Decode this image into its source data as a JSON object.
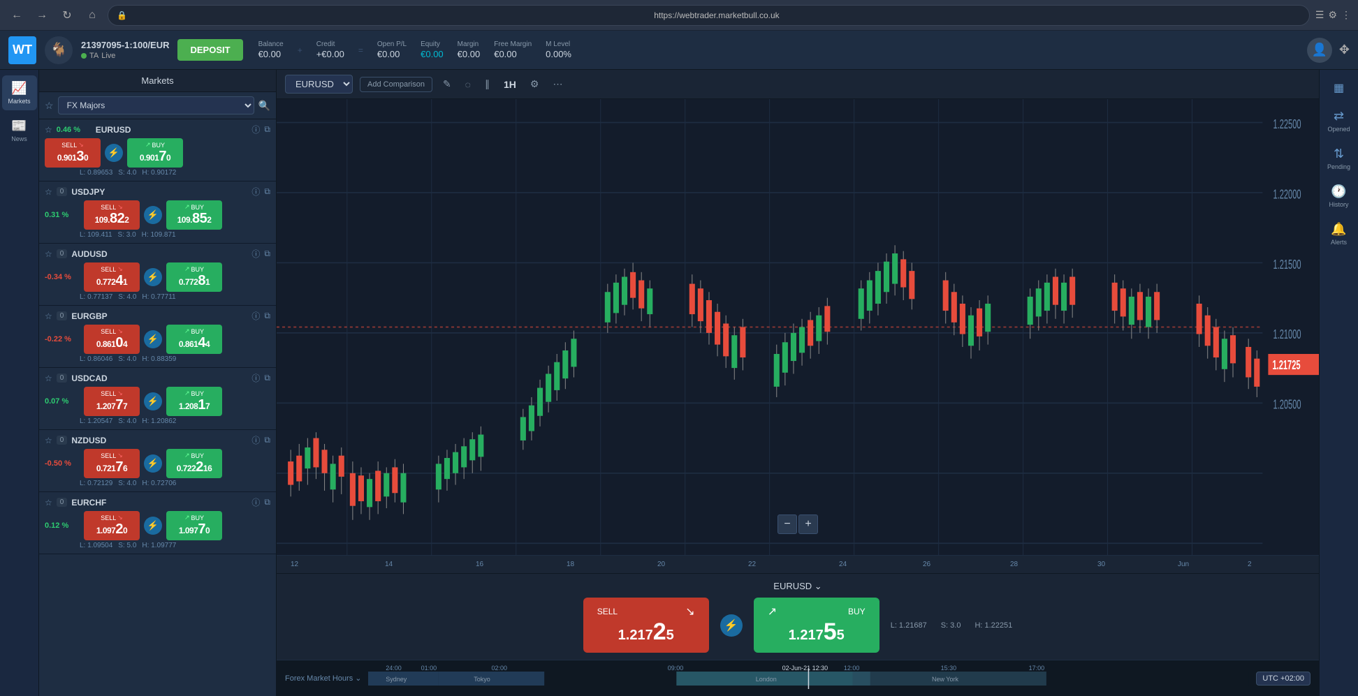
{
  "browser": {
    "url": "https://webtrader.marketbull.co.uk",
    "back": "←",
    "forward": "→",
    "refresh": "↻",
    "home": "⌂"
  },
  "header": {
    "logo_wt": "WT",
    "account_id": "21397095-1:100/EUR",
    "account_ta": "TA",
    "account_live": "Live",
    "deposit_label": "DEPOSIT",
    "balance_label": "Balance",
    "balance_value": "€0.00",
    "credit_label": "Credit",
    "credit_value": "+€0.00",
    "open_pl_label": "Open P/L",
    "open_pl_value": "€0.00",
    "equity_label": "Equity",
    "equity_value": "€0.00",
    "margin_label": "Margin",
    "margin_value": "€0.00",
    "free_margin_label": "Free Margin",
    "free_margin_value": "€0.00",
    "m_level_label": "M Level",
    "m_level_value": "0.00%"
  },
  "sidebar": {
    "markets_label": "Markets",
    "news_label": "News"
  },
  "markets_panel": {
    "title": "Markets",
    "fx_filter": "FX Majors",
    "items": [
      {
        "name": "EURUSD",
        "change": "0.46 %",
        "change_type": "positive",
        "sell_label": "SELL",
        "sell_price_main": "0.9013",
        "sell_price_sub": "0",
        "buy_label": "BUY",
        "buy_price_main": "0.9017",
        "buy_price_sub": "0",
        "low": "L: 0.89653",
        "spread": "S: 4.0",
        "high": "H: 0.90172",
        "count": ""
      },
      {
        "name": "USDJPY",
        "change": "0.31 %",
        "change_type": "positive",
        "sell_label": "SELL",
        "sell_price_main": "109.82",
        "sell_price_sub": "2",
        "buy_label": "BUY",
        "buy_price_main": "109.85",
        "buy_price_sub": "2",
        "low": "L: 109.411",
        "spread": "S: 3.0",
        "high": "H: 109.871",
        "count": "0"
      },
      {
        "name": "AUDUSD",
        "change": "-0.34 %",
        "change_type": "negative",
        "sell_label": "SELL",
        "sell_price_main": "0.7724",
        "sell_price_sub": "1",
        "buy_label": "BUY",
        "buy_price_main": "0.7728",
        "buy_price_sub": "1",
        "low": "L: 0.77137",
        "spread": "S: 4.0",
        "high": "H: 0.77711",
        "count": "0"
      },
      {
        "name": "EURGBP",
        "change": "-0.22 %",
        "change_type": "negative",
        "sell_label": "SELL",
        "sell_price_main": "0.8610",
        "sell_price_sub": "4",
        "buy_label": "BUY",
        "buy_price_main": "0.8614",
        "buy_price_sub": "4",
        "low": "L: 0.86046",
        "spread": "S: 4.0",
        "high": "H: 0.88359",
        "count": "0"
      },
      {
        "name": "USDCAD",
        "change": "0.07 %",
        "change_type": "positive",
        "sell_label": "SELL",
        "sell_price_main": "1.2077",
        "sell_price_sub": "7",
        "buy_label": "BUY",
        "buy_price_main": "1.2081",
        "buy_price_sub": "7",
        "low": "L: 1.20547",
        "spread": "S: 4.0",
        "high": "H: 1.20862",
        "count": "0"
      },
      {
        "name": "NZDUSD",
        "change": "-0.50 %",
        "change_type": "negative",
        "sell_label": "SELL",
        "sell_price_main": "0.7217",
        "sell_price_sub": "6",
        "buy_label": "BUY",
        "buy_price_main": "0.7221",
        "buy_price_sub": "6",
        "low": "L: 0.72129",
        "spread": "S: 4.0",
        "high": "H: 0.72706",
        "count": "0"
      },
      {
        "name": "EURCHF",
        "change": "0.12 %",
        "change_type": "positive",
        "sell_label": "SELL",
        "sell_price_main": "1.0972",
        "sell_price_sub": "0",
        "buy_label": "BUY",
        "buy_price_main": "1.0977",
        "buy_price_sub": "0",
        "low": "L: 1.09504",
        "spread": "S: 5.0",
        "high": "H: 1.09777",
        "count": "0"
      }
    ]
  },
  "chart": {
    "symbol": "EURUSD",
    "add_comparison": "Add Comparison",
    "timeframe": "1H",
    "current_price": "1.21725",
    "price_levels": [
      "1.22500",
      "1.22000",
      "1.21500",
      "1.21000",
      "1.20500"
    ],
    "time_labels": [
      "12",
      "14",
      "16",
      "18",
      "20",
      "22",
      "24",
      "26",
      "28",
      "30",
      "Jun",
      "2"
    ],
    "zoom_minus": "−",
    "zoom_plus": "+"
  },
  "trade_panel": {
    "symbol": "EURUSD",
    "sell_label": "SELL",
    "sell_price": "1.21725",
    "buy_label": "BUY",
    "buy_price": "1.21755",
    "low": "L: 1.21687",
    "spread": "S: 3.0",
    "high": "H: 1.22251"
  },
  "market_hours": {
    "label": "Forex Market Hours",
    "utc": "UTC +02:00",
    "cities": [
      "Sydney",
      "Tokyo",
      "London",
      "New York"
    ],
    "times": [
      "24:00",
      "01:00",
      "02:00",
      "09:00",
      "12:00",
      "15:30",
      "17:00"
    ]
  },
  "right_panel": {
    "opened_label": "Opened",
    "pending_label": "Pending",
    "history_label": "History",
    "alerts_label": "Alerts"
  }
}
